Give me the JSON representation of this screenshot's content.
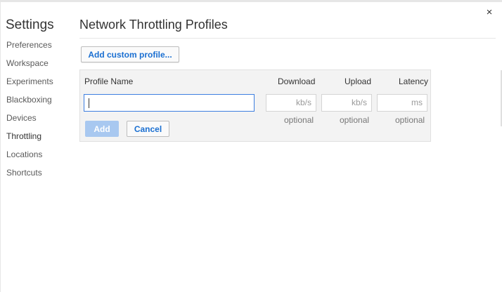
{
  "window": {
    "close_glyph": "×"
  },
  "sidebar": {
    "title": "Settings",
    "items": [
      {
        "label": "Preferences"
      },
      {
        "label": "Workspace"
      },
      {
        "label": "Experiments"
      },
      {
        "label": "Blackboxing"
      },
      {
        "label": "Devices"
      },
      {
        "label": "Throttling"
      },
      {
        "label": "Locations"
      },
      {
        "label": "Shortcuts"
      }
    ],
    "active_item": "Throttling"
  },
  "main": {
    "title": "Network Throttling Profiles",
    "add_custom_label": "Add custom profile...",
    "editor": {
      "columns": {
        "profile_name": "Profile Name",
        "download": "Download",
        "upload": "Upload",
        "latency": "Latency"
      },
      "profile_name_value": "",
      "download_placeholder": "kb/s",
      "upload_placeholder": "kb/s",
      "latency_placeholder": "ms",
      "download_hint": "optional",
      "upload_hint": "optional",
      "latency_hint": "optional",
      "add_label": "Add",
      "cancel_label": "Cancel"
    }
  },
  "colors": {
    "accent": "#1a6fd1",
    "focus_border": "#3d7ee0",
    "add_button_disabled": "#a8c8f0",
    "panel_background": "#f3f3f3"
  }
}
